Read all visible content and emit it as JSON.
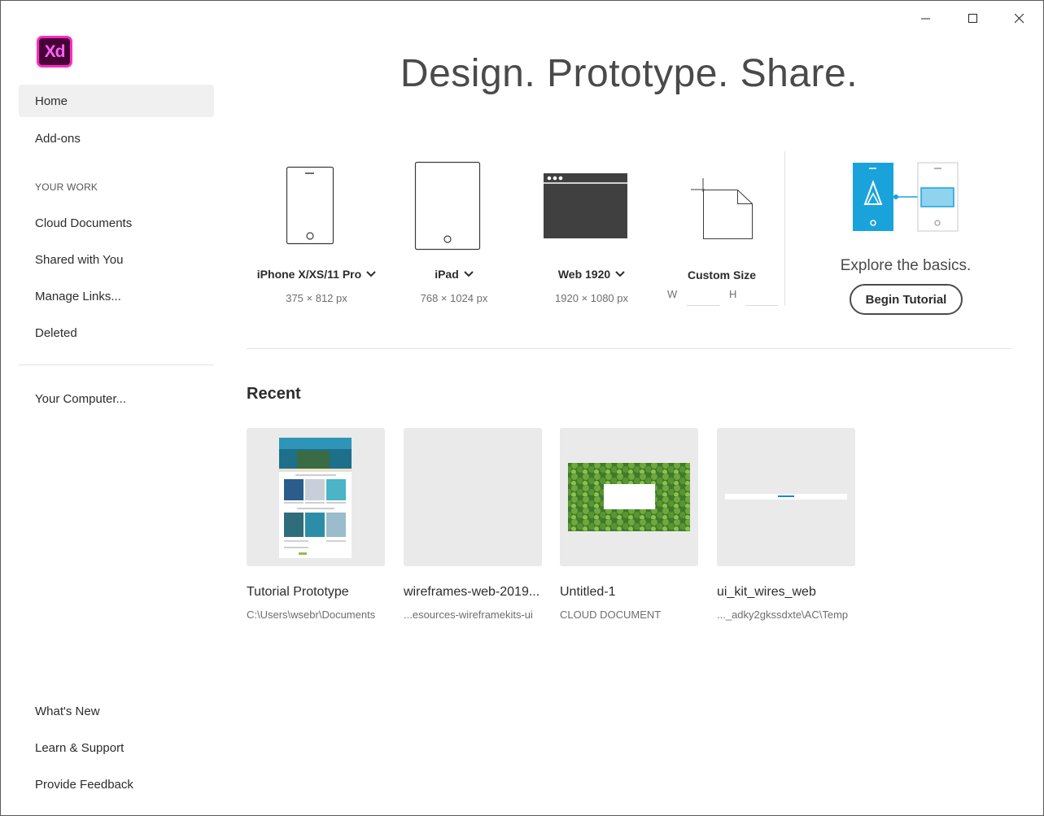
{
  "window_controls": {
    "minimize": "minimize",
    "maximize": "maximize",
    "close": "close"
  },
  "app": {
    "logo_text": "Xd"
  },
  "sidebar": {
    "home": "Home",
    "addons": "Add-ons",
    "section_label": "YOUR WORK",
    "cloud_documents": "Cloud Documents",
    "shared_with_you": "Shared with You",
    "manage_links": "Manage Links...",
    "deleted": "Deleted",
    "your_computer": "Your Computer...",
    "whats_new": "What's New",
    "learn_support": "Learn & Support",
    "provide_feedback": "Provide Feedback"
  },
  "hero": {
    "title": "Design. Prototype. Share."
  },
  "presets": [
    {
      "name": "iPhone X/XS/11 Pro",
      "size": "375 × 812 px"
    },
    {
      "name": "iPad",
      "size": "768 × 1024 px"
    },
    {
      "name": "Web 1920",
      "size": "1920 × 1080 px"
    }
  ],
  "custom_size": {
    "name": "Custom Size",
    "w_label": "W",
    "h_label": "H",
    "w_value": "",
    "h_value": ""
  },
  "tutorial": {
    "explore_text": "Explore the basics.",
    "button_label": "Begin Tutorial"
  },
  "recent": {
    "heading": "Recent",
    "items": [
      {
        "name": "Tutorial Prototype",
        "path": "C:\\Users\\wsebr\\Documents"
      },
      {
        "name": "wireframes-web-2019...",
        "path": "...esources-wireframekits-ui"
      },
      {
        "name": "Untitled-1",
        "path": "CLOUD DOCUMENT"
      },
      {
        "name": "ui_kit_wires_web",
        "path": "..._adky2gkssdxte\\AC\\Temp"
      }
    ]
  },
  "colors": {
    "xd_logo_bg": "#470137",
    "xd_logo_border": "#ff2bc2",
    "tutorial_blue": "#1aa3db",
    "active_nav_bg": "#f0f0f0"
  }
}
